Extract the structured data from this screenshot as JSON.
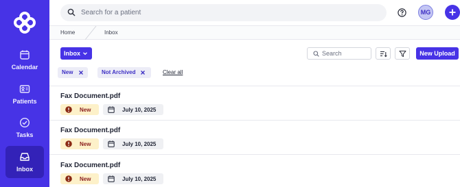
{
  "colors": {
    "brand": "#4733e6",
    "brand_active": "#3322b8",
    "status_new_bg": "#fdf1c9",
    "status_new_text": "#8b1e1e"
  },
  "sidebar": {
    "items": [
      {
        "label": "Calendar",
        "icon": "calendar-icon",
        "active": false
      },
      {
        "label": "Patients",
        "icon": "id-card-icon",
        "active": false
      },
      {
        "label": "Tasks",
        "icon": "check-circle-icon",
        "active": false
      },
      {
        "label": "Inbox",
        "icon": "inbox-icon",
        "active": true
      }
    ]
  },
  "topbar": {
    "search_placeholder": "Search for a patient",
    "avatar_initials": "MG"
  },
  "breadcrumb": {
    "home": "Home",
    "current": "Inbox"
  },
  "toolbar": {
    "view_select": "Inbox",
    "search_placeholder": "Search",
    "upload_label": "New Upload"
  },
  "filters": {
    "chips": [
      "New",
      "Not Archived"
    ],
    "clear_label": "Clear all"
  },
  "documents": [
    {
      "name": "Fax Document.pdf",
      "status": "New",
      "date": "July 10, 2025"
    },
    {
      "name": "Fax Document.pdf",
      "status": "New",
      "date": "July 10, 2025"
    },
    {
      "name": "Fax Document.pdf",
      "status": "New",
      "date": "July 10, 2025"
    }
  ]
}
